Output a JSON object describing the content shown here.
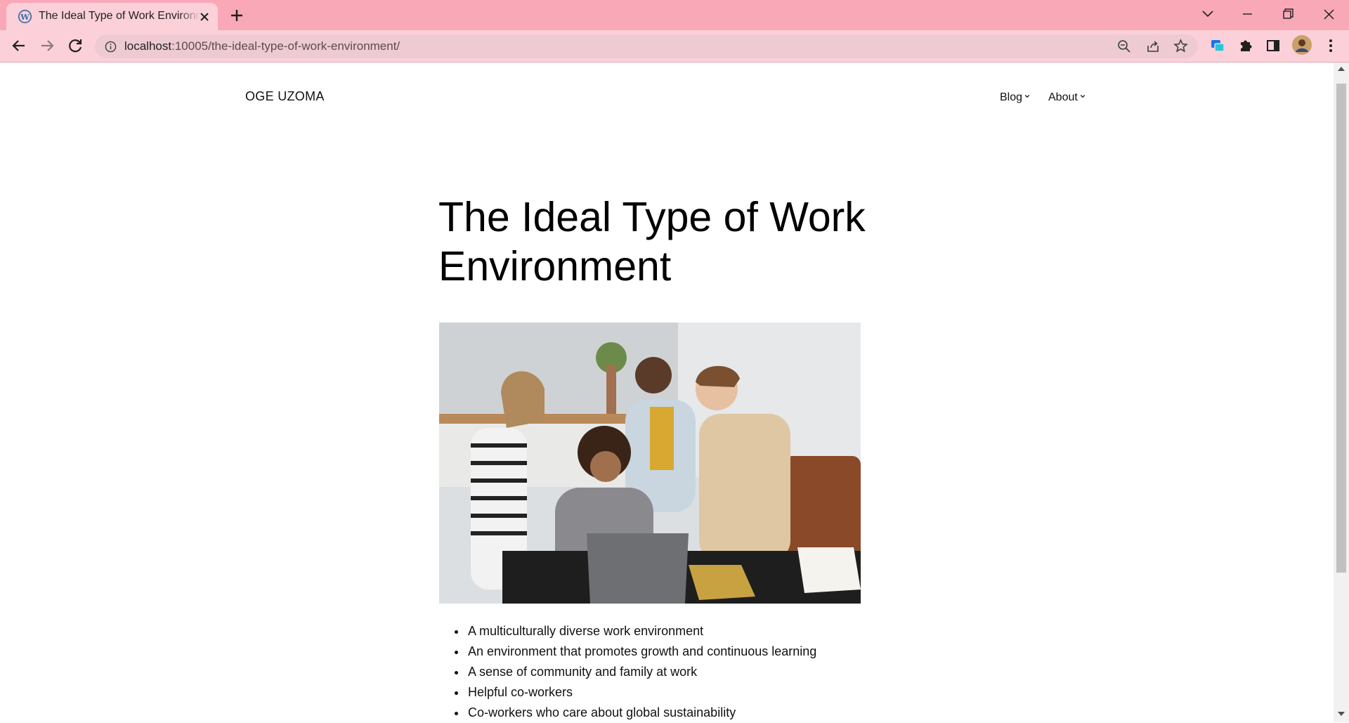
{
  "browser": {
    "tab_title": "The Ideal Type of Work Environment",
    "url_host": "localhost",
    "url_rest": ":10005/the-ideal-type-of-work-environment/",
    "icons": [
      "wordpress-icon",
      "close-icon",
      "plus-icon",
      "chevron-down-icon",
      "minimize-icon",
      "restore-icon",
      "close-window-icon",
      "back-icon",
      "forward-icon",
      "reload-icon",
      "info-icon",
      "zoom-icon",
      "share-icon",
      "star-icon",
      "extension-icon",
      "puzzle-icon",
      "sidepanel-icon",
      "avatar",
      "menu-dots-icon"
    ]
  },
  "site": {
    "title": "OGE UZOMA",
    "nav": [
      {
        "label": "Blog"
      },
      {
        "label": "About"
      }
    ]
  },
  "post": {
    "title": "The Ideal Type of Work Environment",
    "list": [
      "A multiculturally diverse work environment",
      "An environment that promotes growth and continuous learning",
      "A sense of community and family at work",
      "Helpful co-workers",
      "Co-workers who care about global sustainability"
    ]
  },
  "colors": {
    "tabbar": "#f9a8b8",
    "toolbar": "#fbd0d9",
    "omnibox": "#eecbd2"
  }
}
